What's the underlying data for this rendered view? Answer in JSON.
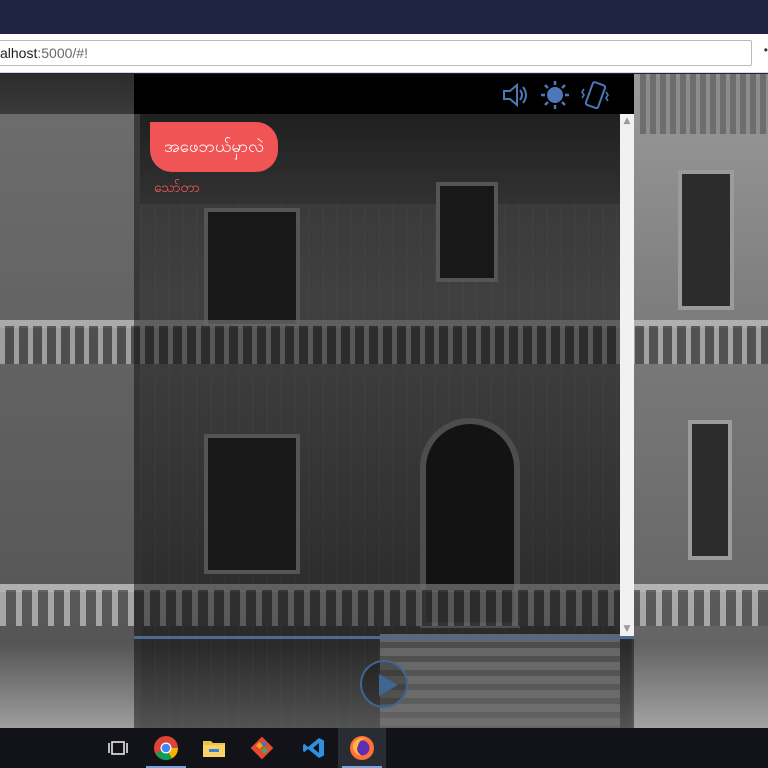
{
  "browser": {
    "url_prefix": "calhost",
    "url_rest": ":5000/#!",
    "menu_glyph": "•"
  },
  "game": {
    "controls": [
      {
        "name": "sound-icon"
      },
      {
        "name": "brightness-icon"
      },
      {
        "name": "vibrate-icon"
      }
    ],
    "message": {
      "text": "အဖေဘယ်မှာလဲ",
      "sender": "သော်တာ"
    },
    "play_label": "▶"
  },
  "taskbar": {
    "items": [
      {
        "name": "task-view-icon"
      },
      {
        "name": "chrome-icon"
      },
      {
        "name": "file-explorer-icon"
      },
      {
        "name": "git-icon"
      },
      {
        "name": "vscode-icon"
      },
      {
        "name": "firefox-icon"
      }
    ]
  },
  "colors": {
    "bubble": "#f05454",
    "sender": "#ff5b5b",
    "accent": "#3f6591",
    "titlebar": "#1f2344"
  }
}
